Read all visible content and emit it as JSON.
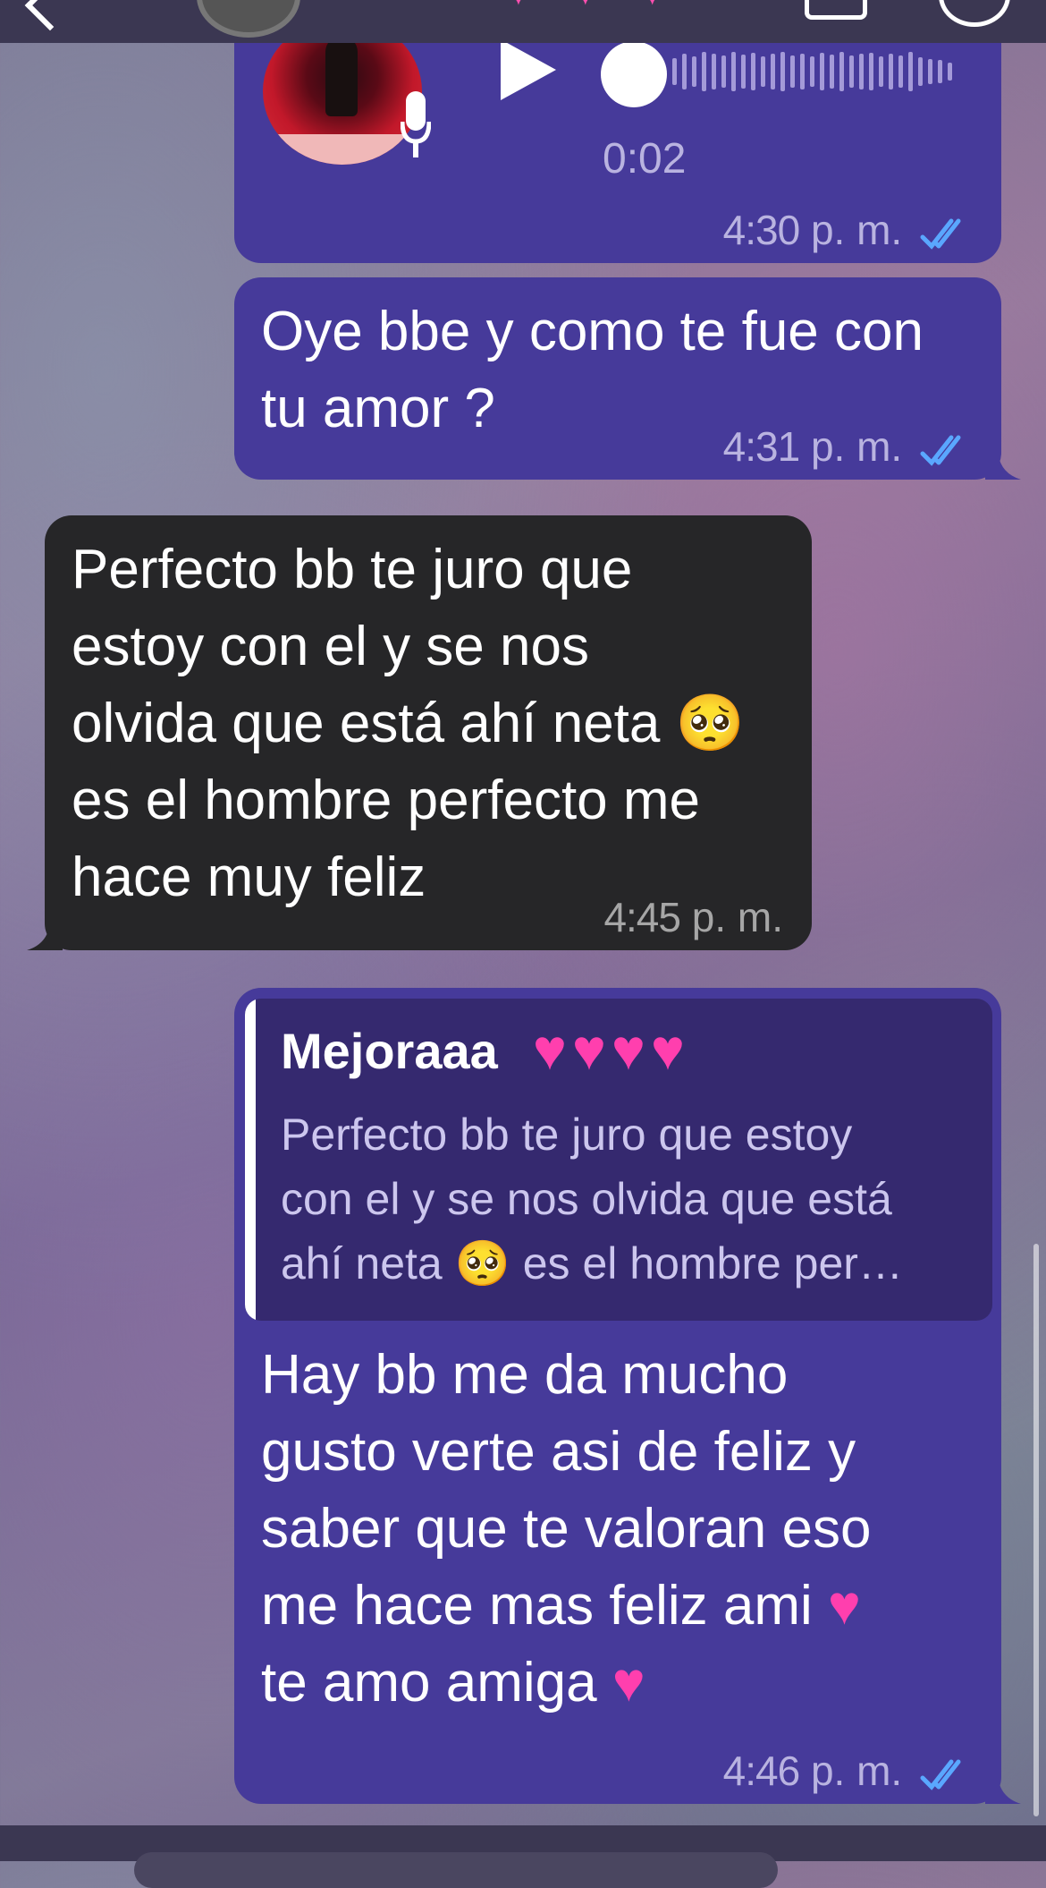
{
  "header": {
    "hearts": "♥ ♥ ♥"
  },
  "messages": {
    "voice": {
      "duration": "0:02",
      "time": "4:30",
      "ampm": "p. m.",
      "status": "read"
    },
    "msg1": {
      "text": "Oye bbe y como te fue con\ntu amor ?",
      "time": "4:31",
      "ampm": "p. m.",
      "status": "read"
    },
    "msg2": {
      "text": "Perfecto bb te juro que\nestoy con el y se nos\nolvida que está ahí neta 🥺\nes el hombre perfecto me\nhace muy feliz",
      "time": "4:45",
      "ampm": "p. m."
    },
    "msg3": {
      "quote_name": "Mejoraaa",
      "quote_hearts": "♥♥♥♥",
      "quote_text": "Perfecto bb te juro que estoy\ncon el y se nos olvida que está\nahí neta 🥺 es el hombre per…",
      "text": "Hay bb me da mucho\ngusto verte asi de feliz y\nsaber que te valoran eso\nme hace mas feliz ami ♥\nte amo amiga ♥",
      "time": "4:46",
      "ampm": "p. m.",
      "status": "read"
    }
  },
  "colors": {
    "outgoing": "#463a9a",
    "incoming": "#262628",
    "quote_bg": "#35296f",
    "heart": "#ff3fae",
    "check": "#5aa7ff"
  },
  "icons": [
    "back-icon",
    "video-call-icon",
    "phone-icon",
    "play-icon",
    "mic-icon",
    "double-check-icon"
  ]
}
